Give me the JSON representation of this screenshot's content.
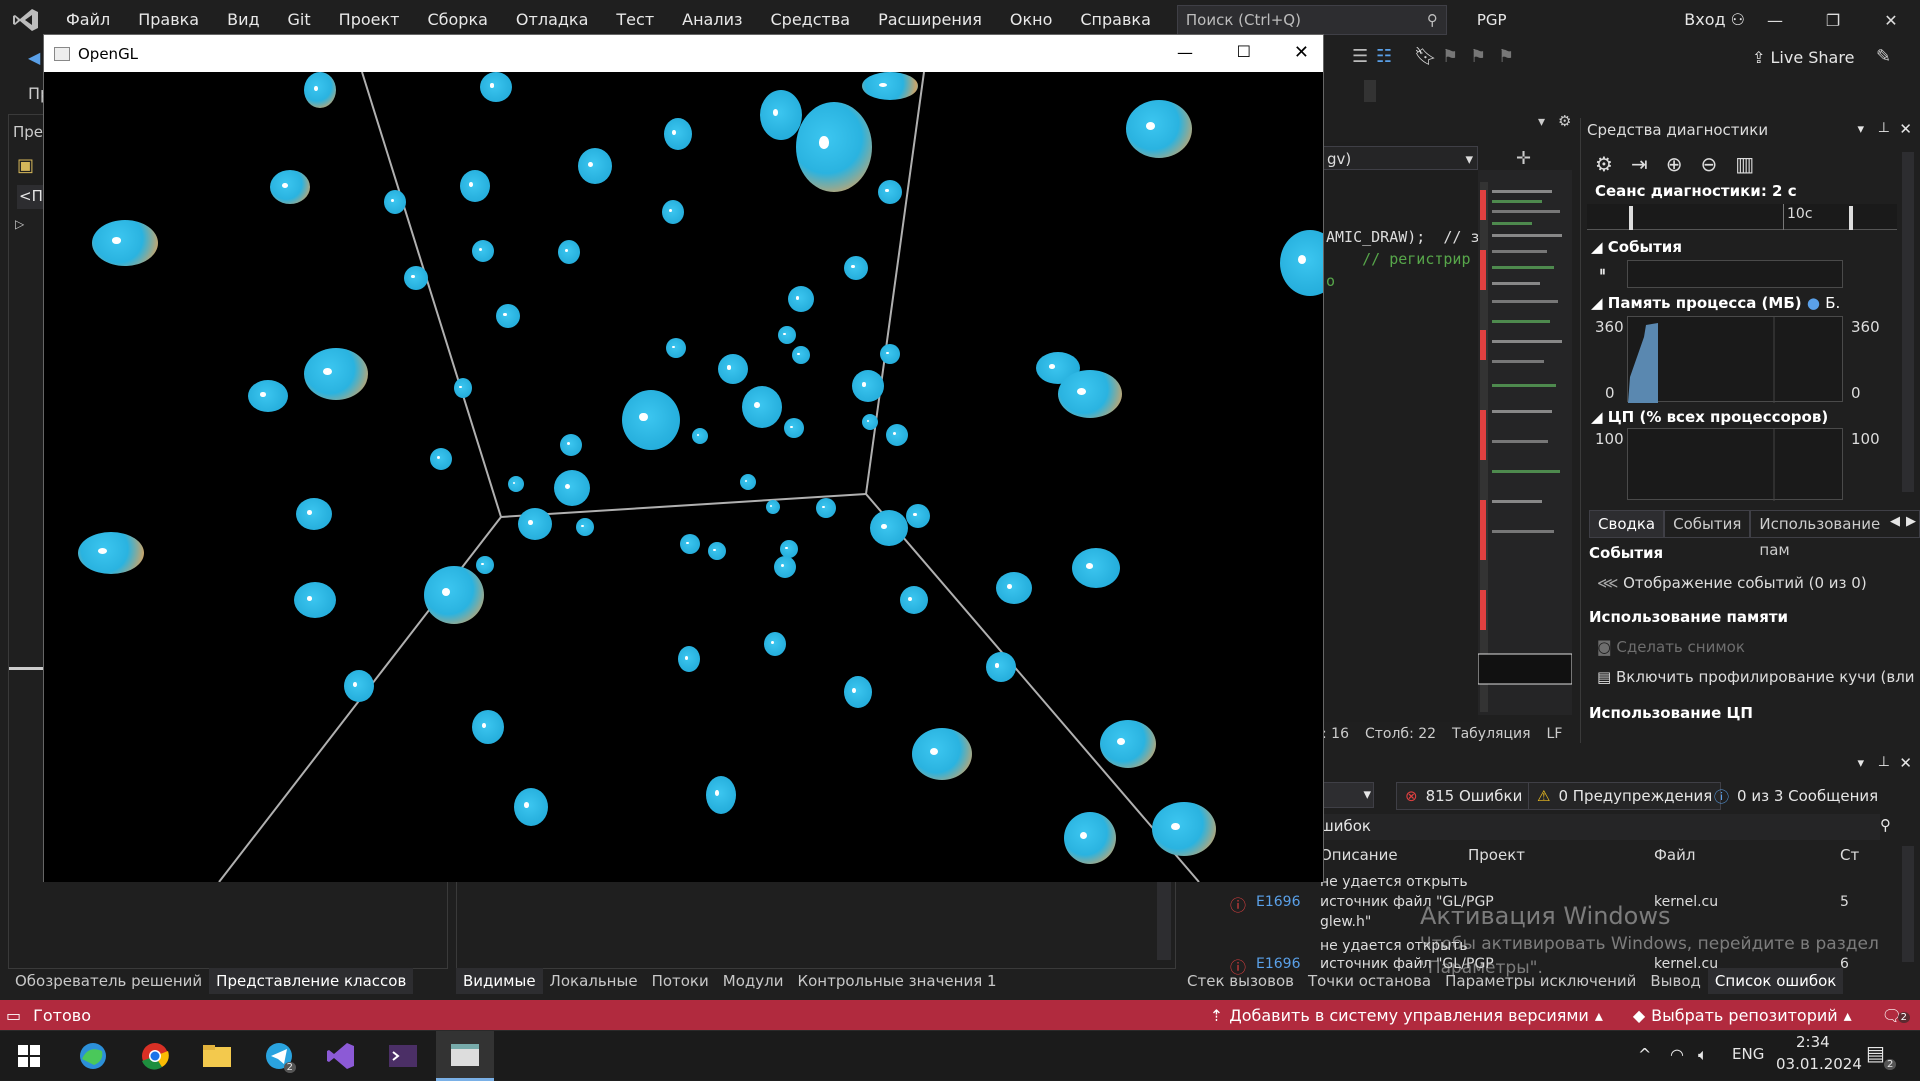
{
  "vs": {
    "menu": [
      "Файл",
      "Правка",
      "Вид",
      "Git",
      "Проект",
      "Сборка",
      "Отладка",
      "Тест",
      "Анализ",
      "Средства",
      "Расширения",
      "Окно",
      "Справка"
    ],
    "search_placeholder": "Поиск (Ctrl+Q)",
    "project": "PGP",
    "signin": "Вход",
    "live_share": "Live Share",
    "left_panel_title_fragment": "Пред",
    "left_toolbar_fragment": "Пр",
    "class_combo_fragment": "<П"
  },
  "gl_window": {
    "title": "OpenGL"
  },
  "editor": {
    "combo": "gv)",
    "line1": "AMIC_DRAW);  // з",
    "line2": "    // регистрир",
    "line3": "о",
    "status_line": ": 16",
    "status_col": "Столб: 22",
    "status_tab": "Табуляция",
    "status_eol": "LF"
  },
  "diagnostics": {
    "title": "Средства диагностики",
    "session": "Сеанс диагностики: 2 с",
    "timeline_label": "10с",
    "events_header": "События",
    "memory_header": "Память процесса (МБ)",
    "memory_legend": "Б.",
    "mem_max_left": "360",
    "mem_min_left": "0",
    "mem_max_right": "360",
    "mem_min_right": "0",
    "cpu_header": "ЦП (% всех процессоров)",
    "cpu_max_left": "100",
    "cpu_max_right": "100",
    "tabs": [
      "Сводка",
      "События",
      "Использование пам"
    ],
    "summary_events_title": "События",
    "summary_events_item": "Отображение событий (0 из 0)",
    "summary_memory_title": "Использование памяти",
    "summary_memory_snapshot": "Сделать снимок",
    "summary_memory_heap": "Включить профилирование кучи (вли",
    "summary_cpu_title": "Использование ЦП"
  },
  "errors": {
    "errors_btn": "815 Ошибки",
    "warnings_btn": "0 Предупреждения",
    "messages_btn": "0 из 3 Сообщения",
    "search_fragment": "шибок",
    "columns": [
      "Описание",
      "Проект",
      "Файл",
      "Ст"
    ],
    "rows": [
      {
        "code": "E1696",
        "desc1": "не удается открыть",
        "desc2": "источник файл \"GL/",
        "desc3": "glew.h\"",
        "project": "PGP",
        "file": "kernel.cu",
        "line": "5"
      },
      {
        "code": "E1696",
        "desc1": "не удается открыть",
        "desc2": "источник файл \"GL/",
        "desc3": "",
        "project": "PGP",
        "file": "kernel.cu",
        "line": "6"
      }
    ]
  },
  "tabs": {
    "left": [
      "Обозреватель решений",
      "Представление классов"
    ],
    "middle": [
      "Видимые",
      "Локальные",
      "Потоки",
      "Модули",
      "Контрольные значения 1"
    ],
    "right": [
      "Стек вызовов",
      "Точки останова",
      "Параметры исключений",
      "Вывод",
      "Список ошибок"
    ]
  },
  "status": {
    "ready": "Готово",
    "add_vcs": "Добавить в систему управления версиями",
    "select_repo": "Выбрать репозиторий",
    "notif_count": "2"
  },
  "watermark": {
    "line1": "Активация Windows",
    "line2": "Чтобы активировать Windows, перейдите в раздел",
    "line3": "\"Параметры\"."
  },
  "taskbar": {
    "lang": "ENG",
    "time": "2:34",
    "date": "03.01.2024",
    "telegram_badge": "2",
    "notif_badge": "2"
  },
  "colors": {
    "statusbar": "#b12a3e",
    "ball": "#2ab3e0",
    "accent": "#7ab0e6"
  }
}
